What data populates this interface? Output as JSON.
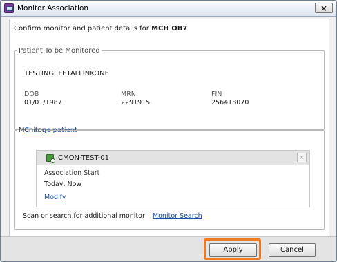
{
  "window": {
    "title": "Monitor Association",
    "close_label": "×"
  },
  "confirm": {
    "prefix": "Confirm monitor and patient details for",
    "location": "MCH OB7"
  },
  "patient": {
    "legend": "Patient To be Monitored",
    "name": "TESTING, FETALLINKONE",
    "dob_label": "DOB",
    "dob_value": "01/01/1987",
    "mrn_label": "MRN",
    "mrn_value": "2291915",
    "fin_label": "FIN",
    "fin_value": "256418070",
    "change_link": "Change patient"
  },
  "monitor": {
    "legend": "Monitor",
    "name": "CMON-TEST-01",
    "remove_label": "×",
    "association_label": "Association Start",
    "association_value": "Today, Now",
    "modify_link": "Modify",
    "scan_text": "Scan or search for additional monitor",
    "search_link": "Monitor Search"
  },
  "buttons": {
    "apply": "Apply",
    "cancel": "Cancel"
  },
  "colors": {
    "highlight": "#ee7a23",
    "link": "#1a4ea8"
  }
}
